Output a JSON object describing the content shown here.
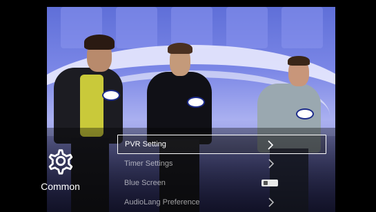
{
  "category": {
    "label": "Common",
    "icon": "gear-icon"
  },
  "menu": {
    "items": [
      {
        "label": "PVR Setting",
        "control": "chevron-right-icon",
        "selected": true
      },
      {
        "label": "Timer Settings",
        "control": "chevron-right-icon",
        "selected": false
      },
      {
        "label": "Blue Screen",
        "control": "toggle",
        "state": "off",
        "selected": false
      },
      {
        "label": "AudioLang Preference",
        "control": "chevron-right-icon",
        "selected": false
      }
    ]
  },
  "badges": [
    "CLIC",
    "CLIC",
    "CLIC"
  ],
  "colors": {
    "accent": "#ffffff",
    "background": "#000000",
    "stage": "#6e78dd"
  }
}
